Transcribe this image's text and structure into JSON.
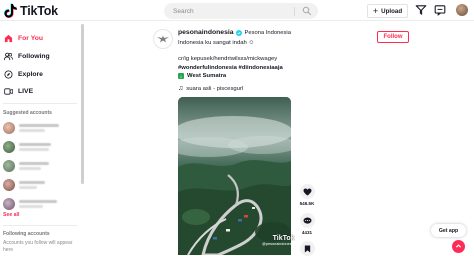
{
  "header": {
    "logo_text": "TikTok",
    "search_placeholder": "Search",
    "upload_label": "Upload"
  },
  "sidebar": {
    "nav": [
      {
        "label": "For You",
        "icon": "home-icon",
        "active": true
      },
      {
        "label": "Following",
        "icon": "people-icon",
        "active": false
      },
      {
        "label": "Explore",
        "icon": "compass-icon",
        "active": false
      },
      {
        "label": "LIVE",
        "icon": "live-icon",
        "active": false
      }
    ],
    "suggested_title": "Suggested accounts",
    "see_all": "See all",
    "following_title": "Following accounts",
    "following_desc": "Accounts you follow will appear here"
  },
  "post": {
    "username": "pesonaindonesia",
    "nickname": "Pesona Indonesia",
    "caption": "Indonesia ku sangat indah ☺",
    "credits": "cr/ig kepusek/hendriwilsss/mickwagey",
    "hashtags": "#wonderfulindonesia #diindonesiaaja",
    "location": "West Sumatra",
    "music": "suara asli - piscesgurl",
    "follow_label": "Follow",
    "likes": "546.5K",
    "comments": "4431",
    "watermark_logo": "TikTok",
    "watermark_handle": "@pesonaindonesia"
  },
  "floating": {
    "get_app": "Get app"
  },
  "colors": {
    "brand": "#fe2c55",
    "verified": "#20d5ec",
    "location": "#2aa44f"
  }
}
